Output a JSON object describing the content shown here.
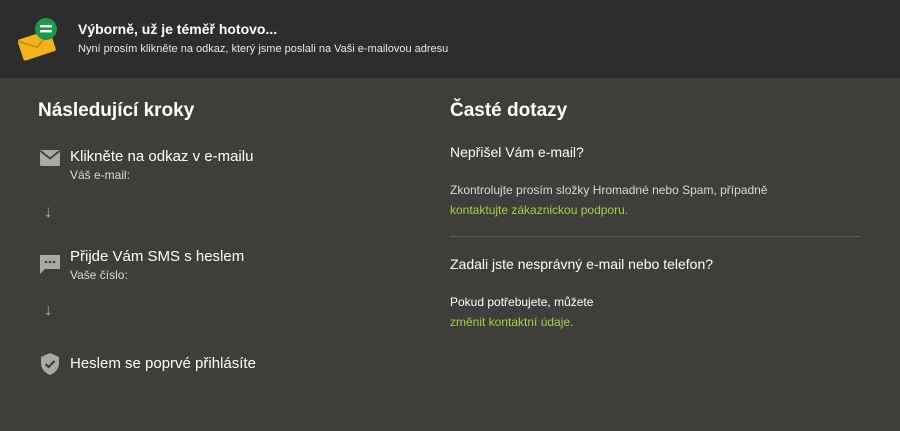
{
  "banner": {
    "title": "Výborně, už je téměř hotovo...",
    "subtitle": "Nyní prosím klikněte na odkaz, který jsme poslali na Vaši e-mailovou adresu"
  },
  "steps_section": {
    "title": "Následující kroky",
    "steps": [
      {
        "title": "Klikněte na odkaz v e-mailu",
        "sub": "Váš e-mail:"
      },
      {
        "title": "Přijde Vám SMS s heslem",
        "sub": "Vaše číslo:"
      },
      {
        "title": "Heslem se poprvé přihlásíte"
      }
    ],
    "arrow": "↓"
  },
  "faq": {
    "title": "Časté dotazy",
    "items": [
      {
        "question": "Nepřišel Vám e-mail?",
        "answer": "Zkontrolujte prosím složky Hromadné nebo Spam, případně",
        "link": "kontaktujte zákaznickou podporu."
      },
      {
        "question": "Zadali jste nesprávný e-mail nebo telefon?",
        "answer": "Pokud potřebujete, můžete",
        "link": "změnit kontaktní údaje."
      }
    ]
  },
  "colors": {
    "background": "#3f3e3b",
    "banner": "#2d2d2d",
    "link": "#9cd34a",
    "icon_badge": "#1a9a4a",
    "envelope": "#f2b21b"
  }
}
